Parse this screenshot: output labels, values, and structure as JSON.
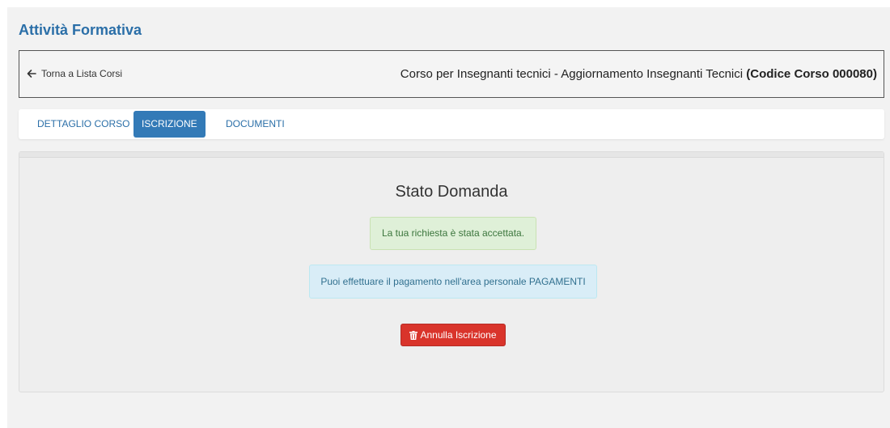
{
  "header": {
    "title": "Attività Formativa"
  },
  "course_bar": {
    "back_label": "Torna a Lista Corsi",
    "course_name": "Corso per Insegnanti tecnici - Aggiornamento Insegnanti Tecnici",
    "course_code": "(Codice Corso 000080)"
  },
  "tabs": [
    {
      "label": "DETTAGLIO CORSO",
      "active": false
    },
    {
      "label": "ISCRIZIONE",
      "active": true
    },
    {
      "label": "DOCUMENTI",
      "active": false
    }
  ],
  "status": {
    "title": "Stato Domanda",
    "success_message": "La tua richiesta è stata accettata.",
    "info_message": "Puoi effettuare il pagamento nell'area personale PAGAMENTI",
    "cancel_button": "Annulla Iscrizione"
  },
  "colors": {
    "accent": "#2b6fa8",
    "active_tab": "#337ab7",
    "success_bg": "#dff0d8",
    "info_bg": "#d9edf7",
    "danger": "#d9342b"
  },
  "icons": {
    "back": "arrow-left-icon",
    "cancel": "trash-icon"
  }
}
